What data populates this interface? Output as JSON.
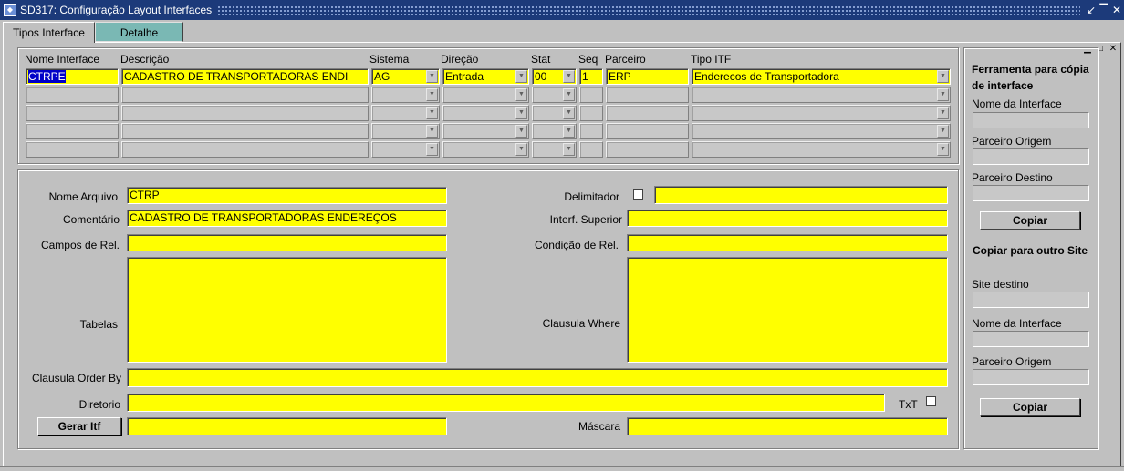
{
  "window": {
    "title": "SD317: Configuração Layout Interfaces"
  },
  "tabs": [
    {
      "label": "Tipos Interface",
      "active": true
    },
    {
      "label": "Detalhe",
      "active": false
    }
  ],
  "grid": {
    "headers": {
      "nome_interface": "Nome Interface",
      "descricao": "Descrição",
      "sistema": "Sistema",
      "direcao": "Direção",
      "stat": "Stat",
      "seq": "Seq",
      "parceiro": "Parceiro",
      "tipo_itf": "Tipo ITF"
    },
    "row1": {
      "nome_interface": "CTRPE",
      "descricao": "CADASTRO DE TRANSPORTADORAS  ENDI",
      "sistema": "AG",
      "direcao": "Entrada",
      "stat": "00",
      "seq": "1",
      "parceiro": "ERP",
      "tipo_itf": "Enderecos de Transportadora"
    }
  },
  "detail": {
    "nome_arquivo_label": "Nome Arquivo",
    "nome_arquivo_value": "CTRP",
    "comentario_label": "Comentário",
    "comentario_value": "CADASTRO DE TRANSPORTADORAS  ENDEREÇOS",
    "campos_rel_label": "Campos de Rel.",
    "tabelas_label": "Tabelas",
    "clausula_order_label": "Clausula Order By",
    "diretorio_label": "Diretorio",
    "gerar_itf_label": "Gerar Itf",
    "delimitador_label": "Delimitador",
    "interf_superior_label": "Interf. Superior",
    "condicao_rel_label": "Condição de Rel.",
    "clausula_where_label": "Clausula Where",
    "txt_label": "TxT",
    "mascara_label": "Máscara"
  },
  "side": {
    "copy_title": "Ferramenta para cópia de interface",
    "nome_interface_label": "Nome da Interface",
    "parceiro_origem_label": "Parceiro Origem",
    "parceiro_destino_label": "Parceiro Destino",
    "copiar_label": "Copiar",
    "site_title": "Copiar para outro Site",
    "site_destino_label": "Site destino",
    "nome_interface2_label": "Nome da Interface",
    "parceiro_origem2_label": "Parceiro Origem",
    "copiar2_label": "Copiar"
  },
  "colors": {
    "required_field": "#ffff00",
    "titlebar": "#1c3a7a",
    "inactive_tab": "#7ab8b4",
    "selection": "#0000c8"
  }
}
